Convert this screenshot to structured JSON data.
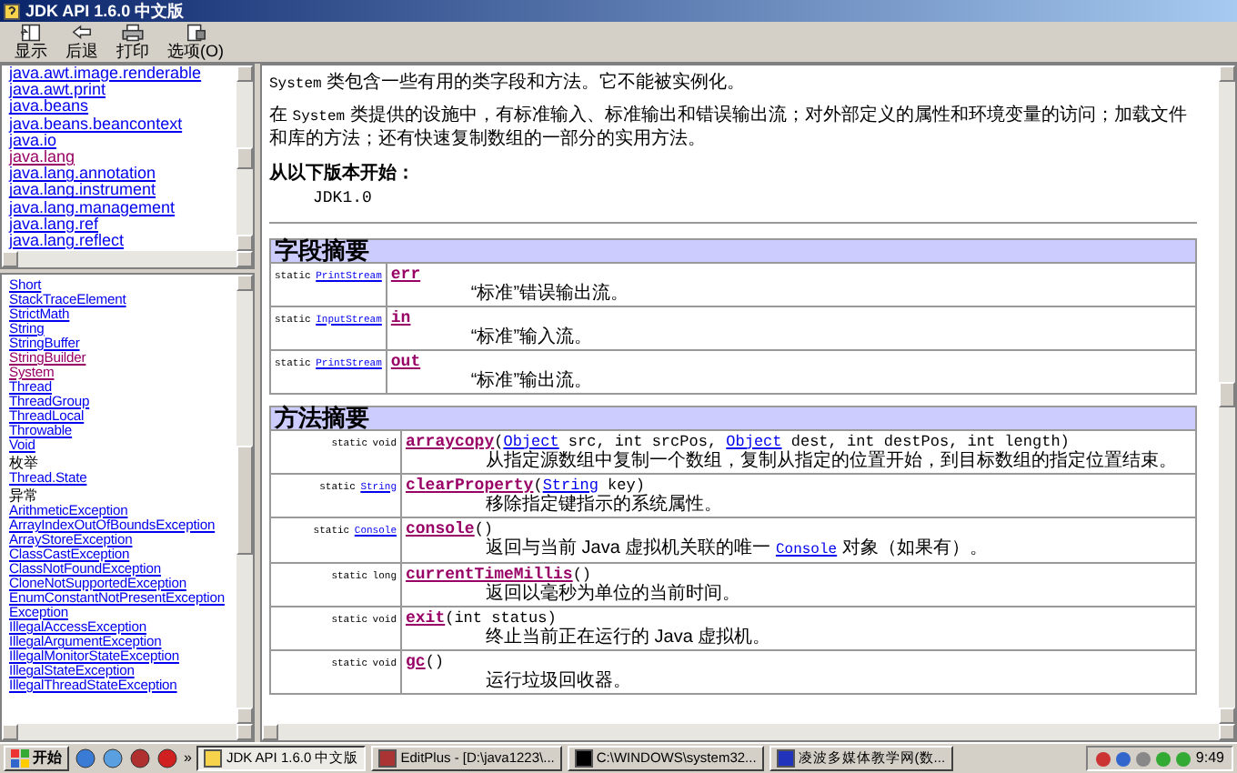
{
  "window": {
    "title": "JDK API 1.6.0 中文版"
  },
  "toolbar": [
    {
      "label": "显示",
      "kind": "show"
    },
    {
      "label": "后退",
      "kind": "back"
    },
    {
      "label": "打印",
      "kind": "print"
    },
    {
      "label": "选项(O)",
      "kind": "options"
    }
  ],
  "packages": [
    {
      "label": "java.awt.image.renderable",
      "visited": false
    },
    {
      "label": "java.awt.print",
      "visited": false
    },
    {
      "label": "java.beans",
      "visited": false
    },
    {
      "label": "java.beans.beancontext",
      "visited": false
    },
    {
      "label": "java.io",
      "visited": false
    },
    {
      "label": "java.lang",
      "visited": true
    },
    {
      "label": "java.lang.annotation",
      "visited": false
    },
    {
      "label": "java.lang.instrument",
      "visited": false
    },
    {
      "label": "java.lang.management",
      "visited": false
    },
    {
      "label": "java.lang.ref",
      "visited": false
    },
    {
      "label": "java.lang.reflect",
      "visited": false
    }
  ],
  "class_list": [
    {
      "kind": "link",
      "label": "Short",
      "visited": false
    },
    {
      "kind": "link",
      "label": "StackTraceElement",
      "visited": false
    },
    {
      "kind": "link",
      "label": "StrictMath",
      "visited": false
    },
    {
      "kind": "link",
      "label": "String",
      "visited": false
    },
    {
      "kind": "link",
      "label": "StringBuffer",
      "visited": false
    },
    {
      "kind": "link",
      "label": "StringBuilder",
      "visited": true
    },
    {
      "kind": "link",
      "label": "System",
      "visited": true
    },
    {
      "kind": "link",
      "label": "Thread",
      "visited": false
    },
    {
      "kind": "link",
      "label": "ThreadGroup",
      "visited": false
    },
    {
      "kind": "link",
      "label": "ThreadLocal",
      "visited": false
    },
    {
      "kind": "link",
      "label": "Throwable",
      "visited": false
    },
    {
      "kind": "link",
      "label": "Void",
      "visited": false
    },
    {
      "kind": "heading",
      "label": "枚举"
    },
    {
      "kind": "link",
      "label": "Thread.State",
      "visited": false
    },
    {
      "kind": "heading",
      "label": "异常"
    },
    {
      "kind": "link",
      "label": "ArithmeticException",
      "visited": false
    },
    {
      "kind": "link",
      "label": "ArrayIndexOutOfBoundsException",
      "visited": false
    },
    {
      "kind": "link",
      "label": "ArrayStoreException",
      "visited": false
    },
    {
      "kind": "link",
      "label": "ClassCastException",
      "visited": false
    },
    {
      "kind": "link",
      "label": "ClassNotFoundException",
      "visited": false
    },
    {
      "kind": "link",
      "label": "CloneNotSupportedException",
      "visited": false
    },
    {
      "kind": "link",
      "label": "EnumConstantNotPresentException",
      "visited": false
    },
    {
      "kind": "link",
      "label": "Exception",
      "visited": false
    },
    {
      "kind": "link",
      "label": "IllegalAccessException",
      "visited": false
    },
    {
      "kind": "link",
      "label": "IllegalArgumentException",
      "visited": false
    },
    {
      "kind": "link",
      "label": "IllegalMonitorStateException",
      "visited": false
    },
    {
      "kind": "link",
      "label": "IllegalStateException",
      "visited": false
    },
    {
      "kind": "link",
      "label": "IllegalThreadStateException",
      "visited": false
    }
  ],
  "content": {
    "paragraphs": [
      [
        {
          "text": "System",
          "code": true
        },
        {
          "text": " 类包含一些有用的类字段和方法。它不能被实例化。",
          "code": false
        }
      ],
      [
        {
          "text": "在 ",
          "code": false
        },
        {
          "text": "System",
          "code": true
        },
        {
          "text": " 类提供的设施中，有标准输入、标准输出和错误输出流；对外部定义的属性和环境变量的访问；加载文件和库的方法；还有快速复制数组的一部分的实用方法。",
          "code": false
        }
      ]
    ],
    "since_label": "从以下版本开始：",
    "since_value": "JDK1.0"
  },
  "field_summary": {
    "title": "字段摘要",
    "rows": [
      {
        "modifier": "static",
        "type": "PrintStream",
        "name": "err",
        "description": "“标准”错误输出流。"
      },
      {
        "modifier": "static",
        "type": "InputStream",
        "name": "in",
        "description": "“标准”输入流。"
      },
      {
        "modifier": "static",
        "type": "PrintStream",
        "name": "out",
        "description": "“标准”输出流。"
      }
    ]
  },
  "method_summary": {
    "title": "方法摘要",
    "rows": [
      {
        "modifier": "static",
        "type": "void",
        "type_link": false,
        "name": "arraycopy",
        "params": [
          {
            "text": "(",
            "link": false
          },
          {
            "text": "Object",
            "link": true
          },
          {
            "text": " src, int srcPos, ",
            "link": false
          },
          {
            "text": "Object",
            "link": true
          },
          {
            "text": " dest, int destPos, int length)",
            "link": false
          }
        ],
        "description": [
          {
            "text": "从指定源数组中复制一个数组，复制从指定的位置开始，到目标数组的指定位置结束。",
            "link": false
          }
        ]
      },
      {
        "modifier": "static",
        "type": "String",
        "type_link": true,
        "name": "clearProperty",
        "params": [
          {
            "text": "(",
            "link": false
          },
          {
            "text": "String",
            "link": true
          },
          {
            "text": " key)",
            "link": false
          }
        ],
        "description": [
          {
            "text": "移除指定键指示的系统属性。",
            "link": false
          }
        ]
      },
      {
        "modifier": "static",
        "type": "Console",
        "type_link": true,
        "name": "console",
        "params": [
          {
            "text": "()",
            "link": false
          }
        ],
        "description": [
          {
            "text": "返回与当前 Java 虚拟机关联的唯一 ",
            "link": false
          },
          {
            "text": "Console",
            "link": true
          },
          {
            "text": " 对象（如果有）。",
            "link": false
          }
        ]
      },
      {
        "modifier": "static",
        "type": "long",
        "type_link": false,
        "name": "currentTimeMillis",
        "params": [
          {
            "text": "()",
            "link": false
          }
        ],
        "description": [
          {
            "text": "返回以毫秒为单位的当前时间。",
            "link": false
          }
        ]
      },
      {
        "modifier": "static",
        "type": "void",
        "type_link": false,
        "name": "exit",
        "params": [
          {
            "text": "(int status)",
            "link": false
          }
        ],
        "description": [
          {
            "text": "终止当前正在运行的 Java 虚拟机。",
            "link": false
          }
        ]
      },
      {
        "modifier": "static",
        "type": "void",
        "type_link": false,
        "name": "gc",
        "params": [
          {
            "text": "()",
            "link": false
          }
        ],
        "description": [
          {
            "text": "运行垃圾回收器。",
            "link": false
          }
        ]
      }
    ]
  },
  "taskbar": {
    "start": "开始",
    "chevron": "»",
    "tasks": [
      {
        "label": "JDK API 1.6.0 中文版",
        "selected": true,
        "kind": "help"
      },
      {
        "label": "EditPlus - [D:\\java1223\\...",
        "selected": false,
        "kind": "editor"
      },
      {
        "label": "C:\\WINDOWS\\system32...",
        "selected": false,
        "kind": "console"
      },
      {
        "label": "凌波多媒体教学网(数...",
        "selected": false,
        "kind": "app"
      }
    ],
    "clock": "9:49"
  }
}
